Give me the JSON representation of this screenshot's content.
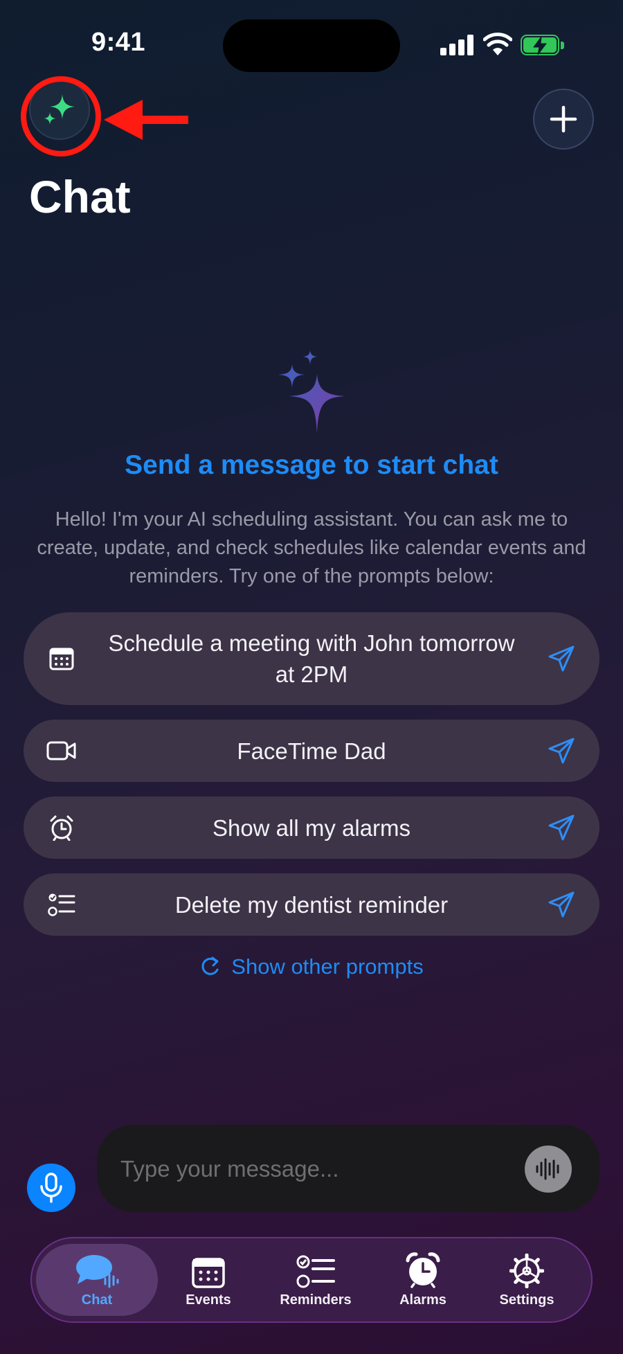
{
  "status_bar": {
    "time": "9:41"
  },
  "header": {
    "title": "Chat"
  },
  "empty_state": {
    "headline": "Send a message to start chat",
    "intro": "Hello! I'm your AI scheduling assistant. You can ask me to create, update, and check schedules like calendar events and reminders. Try one of the prompts below:"
  },
  "prompts": [
    {
      "label": "Schedule a meeting with John tomorrow at 2PM",
      "icon": "calendar-icon"
    },
    {
      "label": "FaceTime Dad",
      "icon": "video-camera-icon"
    },
    {
      "label": "Show all my alarms",
      "icon": "alarm-clock-icon"
    },
    {
      "label": "Delete my dentist reminder",
      "icon": "checklist-icon"
    }
  ],
  "show_other_prompts": "Show other prompts",
  "composer": {
    "placeholder": "Type your message..."
  },
  "tabs": [
    {
      "label": "Chat",
      "active": true
    },
    {
      "label": "Events",
      "active": false
    },
    {
      "label": "Reminders",
      "active": false
    },
    {
      "label": "Alarms",
      "active": false
    },
    {
      "label": "Settings",
      "active": false
    }
  ],
  "colors": {
    "accent": "#1e8cf5",
    "highlight": "#ff1a12",
    "sparkle": "#3ddc84",
    "chip": "#3d3448"
  }
}
